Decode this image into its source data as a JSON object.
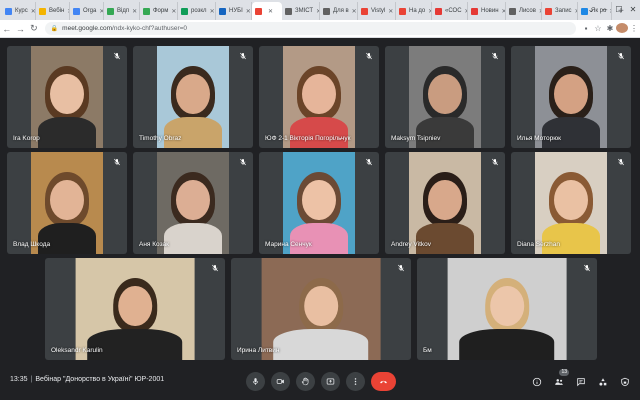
{
  "browser": {
    "tabs": [
      {
        "label": "Курс",
        "color": "#4285f4"
      },
      {
        "label": "Вебін",
        "color": "#f4b400"
      },
      {
        "label": "Orga",
        "color": "#4285f4"
      },
      {
        "label": "Відп",
        "color": "#34a853"
      },
      {
        "label": "Форм",
        "color": "#34a853"
      },
      {
        "label": "розкл",
        "color": "#0f9d58"
      },
      {
        "label": "НУБІ",
        "color": "#1565c0"
      },
      {
        "label": "",
        "color": "#ea4335",
        "active": true
      },
      {
        "label": "ЗМІСТ",
        "color": "#616161"
      },
      {
        "label": "Для в",
        "color": "#616161"
      },
      {
        "label": "Vistyl",
        "color": "#ea4335"
      },
      {
        "label": "На до",
        "color": "#ea4335"
      },
      {
        "label": "«СОС",
        "color": "#e53935"
      },
      {
        "label": "Новин",
        "color": "#e53935"
      },
      {
        "label": "Лисов",
        "color": "#616161"
      },
      {
        "label": "Запис",
        "color": "#ea4335"
      },
      {
        "label": "Як ро",
        "color": "#1e88e5"
      }
    ],
    "new_tab": "+",
    "url_host": "meet.google.com",
    "url_rest": "/ndx-kyko-chf?authuser=0"
  },
  "participants": [
    {
      "name": "Ira Korop",
      "bg": "#8c7a66",
      "skin": "#e8bfa3",
      "hair": "#5a3a22",
      "shirt": "#2b2b2b"
    },
    {
      "name": "Timothy Obraz",
      "bg": "#a9c8d8",
      "skin": "#d9a98a",
      "hair": "#3a2a1e",
      "shirt": "#c9a46a"
    },
    {
      "name": "ЮФ 2-1 Вікторія Погорільчук",
      "bg": "#b39a86",
      "skin": "#e6b59a",
      "hair": "#6b4428",
      "shirt": "#d64a4a"
    },
    {
      "name": "Maksym Tsipniev",
      "bg": "#7c7c7c",
      "skin": "#c99c80",
      "hair": "#2a2a2a",
      "shirt": "#3a3a3a"
    },
    {
      "name": "Илья Моторюк",
      "bg": "#8d9096",
      "skin": "#d4a183",
      "hair": "#2a2019",
      "shirt": "#2f3136"
    },
    {
      "name": "Влад Шкода",
      "bg": "#b88a4e",
      "skin": "#e2b496",
      "hair": "#6e4a2c",
      "shirt": "#1f1f1f"
    },
    {
      "name": "Аня Козак",
      "bg": "#6e6a63",
      "skin": "#dcae94",
      "hair": "#3b2a1f",
      "shirt": "#d9d3cc"
    },
    {
      "name": "Марина Сенчук",
      "bg": "#4fa3c7",
      "skin": "#edc2a6",
      "hair": "#6b4a35",
      "shirt": "#e891b5"
    },
    {
      "name": "Andrey Vitkov",
      "bg": "#c9b9a4",
      "skin": "#d8a88b",
      "hair": "#2a1e18",
      "shirt": "#6b4a30"
    },
    {
      "name": "Diana Serzhan",
      "bg": "#d8cfc2",
      "skin": "#eac1a3",
      "hair": "#8a5a34",
      "shirt": "#e8c54a"
    },
    {
      "name": "Oleksandr Karulin",
      "bg": "#d6c6a8",
      "skin": "#e0b191",
      "hair": "#3a2a1c",
      "shirt": "#222222"
    },
    {
      "name": "Ирина Литвин",
      "bg": "#8c6a55",
      "skin": "#e9bfa2",
      "hair": "#8d6a4a",
      "shirt": "#d8d8d8"
    },
    {
      "name": "Бм",
      "bg": "#cfcfcf",
      "skin": "#ecc6aa",
      "hair": "#d4b07a",
      "shirt": "#1f1f1f"
    }
  ],
  "bottom": {
    "time": "13:35",
    "separator": "|",
    "meeting_title": "Вебінар \"Донорство в Україні\" ЮР-2001",
    "participant_count": "13"
  },
  "colors": {
    "end_call": "#ea4335",
    "tile_bg": "#3c4043",
    "page_bg": "#202124"
  }
}
